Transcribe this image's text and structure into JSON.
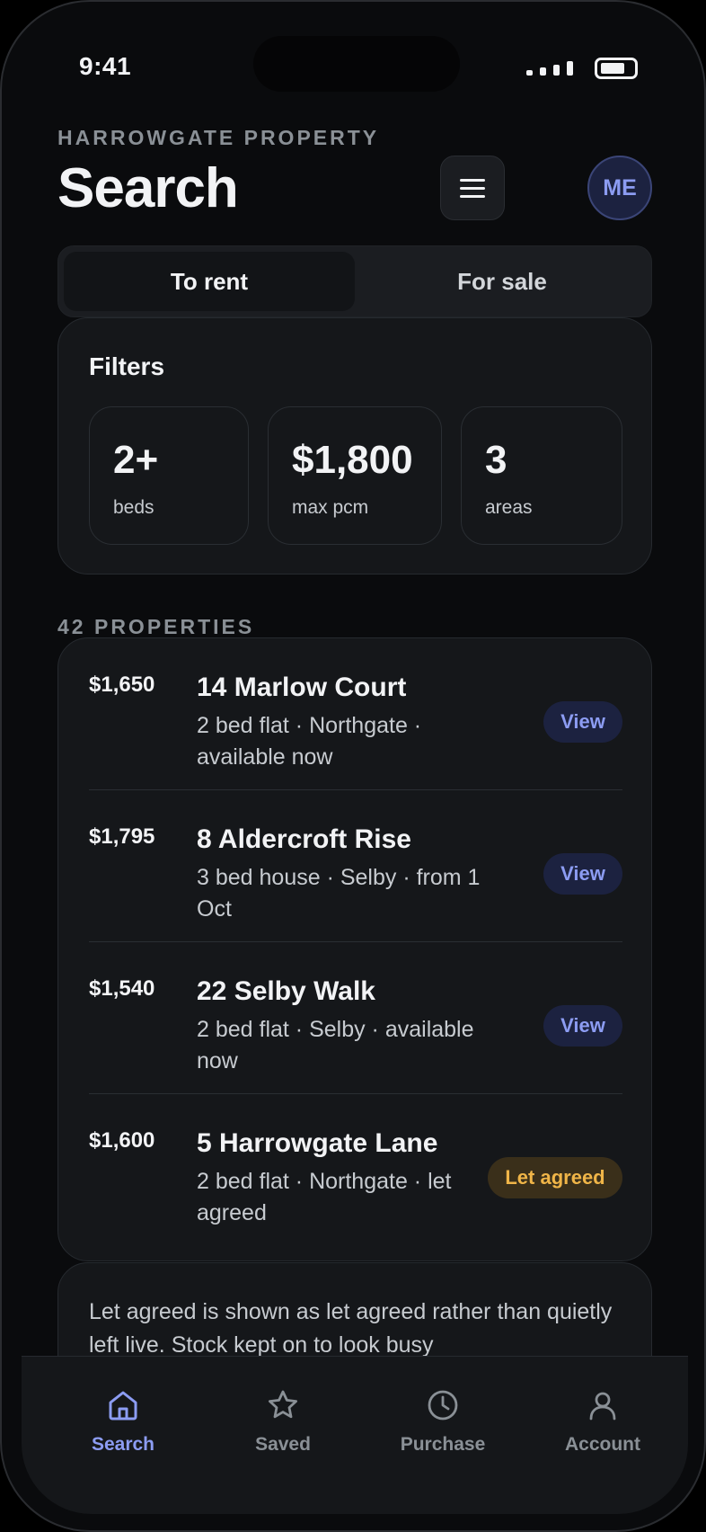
{
  "status_bar": {
    "time": "9:41"
  },
  "header": {
    "eyebrow": "HARROWGATE PROPERTY",
    "title": "Search",
    "menu_icon": "hamburger-icon",
    "avatar_initials": "ME"
  },
  "segment": {
    "options": [
      "To rent",
      "For sale"
    ],
    "selected": "To rent"
  },
  "filters": {
    "title": "Filters",
    "chips": [
      {
        "value": "2+",
        "label": "beds"
      },
      {
        "value": "$1,800",
        "label": "max pcm"
      },
      {
        "value": "3",
        "label": "areas"
      }
    ]
  },
  "results": {
    "count_label": "42 PROPERTIES",
    "items": [
      {
        "price": "$1,650",
        "title": "14 Marlow Court",
        "subtitle": "2 bed flat · Northgate · available now",
        "action": "View",
        "status": "view"
      },
      {
        "price": "$1,795",
        "title": "8 Aldercroft Rise",
        "subtitle": "3 bed house · Selby · from 1 Oct",
        "action": "View",
        "status": "view"
      },
      {
        "price": "$1,540",
        "title": "22 Selby Walk",
        "subtitle": "2 bed flat · Selby · available now",
        "action": "View",
        "status": "view"
      },
      {
        "price": "$1,600",
        "title": "5 Harrowgate Lane",
        "subtitle": "2 bed flat · Northgate · let agreed",
        "action": "Let agreed",
        "status": "let-agreed"
      }
    ]
  },
  "note": {
    "text": "Let agreed is shown as let agreed rather than quietly left live. Stock kept on to look busy"
  },
  "tabbar": {
    "items": [
      {
        "label": "Search",
        "icon": "home-icon",
        "active": true
      },
      {
        "label": "Saved",
        "icon": "star-icon",
        "active": false
      },
      {
        "label": "Purchase",
        "icon": "clock-icon",
        "active": false
      },
      {
        "label": "Account",
        "icon": "user-icon",
        "active": false
      }
    ]
  },
  "colors": {
    "background": "#0a0b0d",
    "card": "#15171a",
    "accent": "#8c9cf2",
    "accent_bg": "#1c2240",
    "warning": "#f0b548",
    "warning_bg": "#3a2f1a",
    "muted": "#8a9096"
  }
}
